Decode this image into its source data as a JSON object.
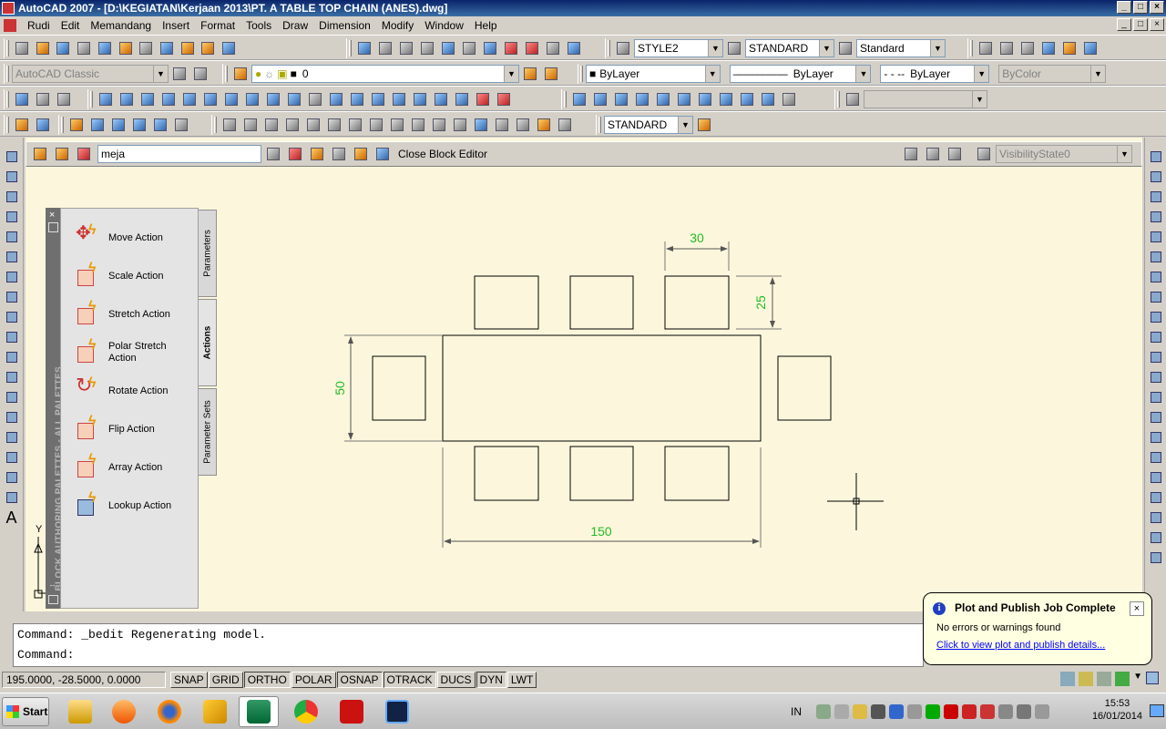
{
  "window": {
    "title": "AutoCAD 2007 - [D:\\KEGIATAN\\Kerjaan 2013\\PT. A TABLE TOP CHAIN (ANES).dwg]"
  },
  "menu": [
    "Rudi",
    "Edit",
    "Memandang",
    "Insert",
    "Format",
    "Tools",
    "Draw",
    "Dimension",
    "Modify",
    "Window",
    "Help"
  ],
  "toolbar": {
    "text_style": "STYLE2",
    "dim_style": "STANDARD",
    "table_style": "Standard",
    "workspace": "AutoCAD Classic",
    "layer": "0",
    "color": "ByLayer",
    "linetype": "ByLayer",
    "lineweight": "ByLayer",
    "plotstyle": "ByColor",
    "dim_style2": "STANDARD"
  },
  "block_editor": {
    "block_name": "meja",
    "close_label": "Close Block Editor",
    "visibility_state": "VisibilityState0"
  },
  "palette": {
    "title": "BLOCK AUTHORING PALETTES - ALL PALETTES",
    "tabs": [
      "Parameters",
      "Actions",
      "Parameter Sets"
    ],
    "active_tab": "Actions",
    "items": [
      {
        "label": "Move Action"
      },
      {
        "label": "Scale Action"
      },
      {
        "label": "Stretch Action"
      },
      {
        "label": "Polar Stretch Action"
      },
      {
        "label": "Rotate Action"
      },
      {
        "label": "Flip Action"
      },
      {
        "label": "Array Action"
      },
      {
        "label": "Lookup Action"
      }
    ]
  },
  "drawing": {
    "dim_top": "30",
    "dim_right": "25",
    "dim_left": "50",
    "dim_bottom": "150",
    "dim_color": "#22bb22",
    "ucs_y": "Y"
  },
  "command": {
    "line1": "Command: _bedit Regenerating model.",
    "line2": "Command:"
  },
  "status": {
    "coords": "195.0000, -28.5000, 0.0000",
    "buttons": [
      "SNAP",
      "GRID",
      "ORTHO",
      "POLAR",
      "OSNAP",
      "OTRACK",
      "DUCS",
      "DYN",
      "LWT"
    ],
    "pressed": [
      "ORTHO",
      "OSNAP",
      "OTRACK",
      "DYN"
    ]
  },
  "notification": {
    "title": "Plot and Publish Job Complete",
    "message": "No errors or warnings found",
    "link": "Click to view plot and publish details..."
  },
  "taskbar": {
    "start": "Start",
    "lang": "IN",
    "time": "15:53",
    "date": "16/01/2014"
  }
}
